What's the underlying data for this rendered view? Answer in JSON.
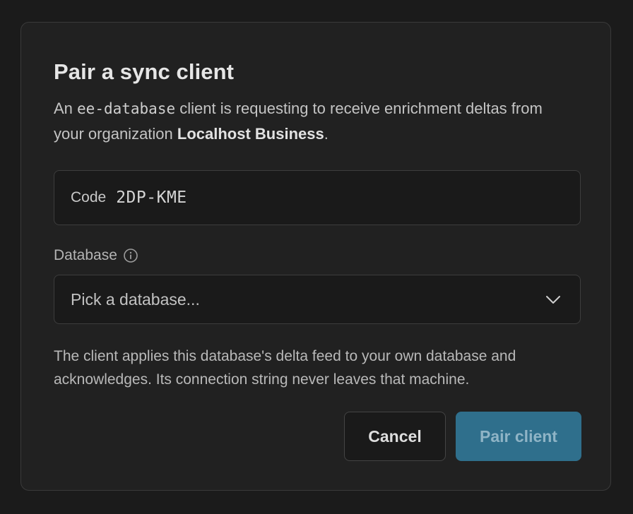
{
  "dialog": {
    "title": "Pair a sync client",
    "description": {
      "prefix": "An ",
      "client_name": "ee-database",
      "middle": " client is requesting to receive enrichment deltas from your organization ",
      "organization": "Localhost Business",
      "suffix": "."
    },
    "code": {
      "label": "Code",
      "value": "2DP-KME"
    },
    "database": {
      "label": "Database",
      "placeholder": "Pick a database..."
    },
    "helper_text": "The client applies this database's delta feed to your own database and acknowledges. Its connection string never leaves that machine.",
    "buttons": {
      "cancel": "Cancel",
      "pair": "Pair client"
    }
  },
  "icons": {
    "info": "info-icon",
    "chevron": "chevron-down-icon"
  },
  "colors": {
    "background": "#1b1b1b",
    "dialog": "#212121",
    "primary_button": "#2f6f8c",
    "primary_button_text": "#8fb4c6"
  }
}
